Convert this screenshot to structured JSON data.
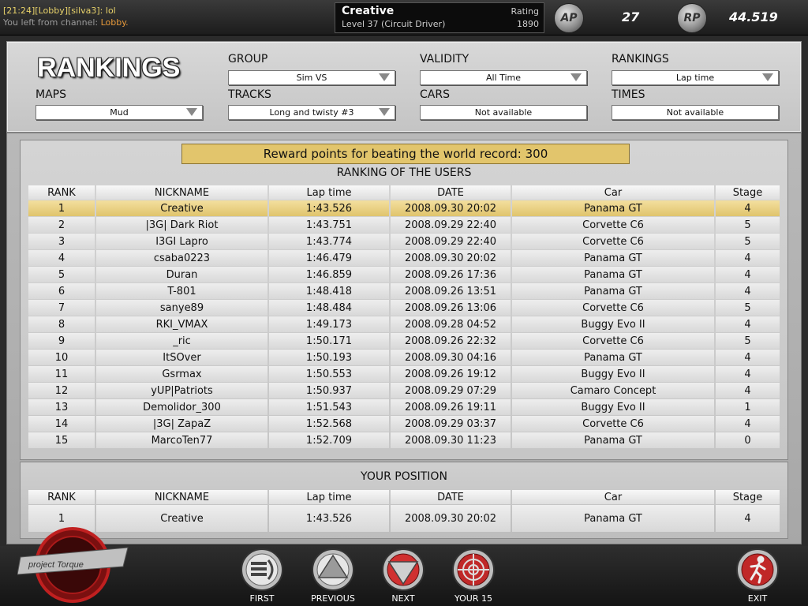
{
  "chat": {
    "line1": "[21:24][Lobby][silva3]: lol",
    "line2_prefix": "You left from channel: ",
    "line2_channel": "Lobby."
  },
  "player": {
    "name": "Creative",
    "level": "Level 37 (Circuit Driver)",
    "rating_label": "Rating",
    "rating_value": "1890"
  },
  "stats": {
    "coin1_icon": "AP-coin-icon",
    "coin1_value": "27",
    "coin2_icon": "RP-coin-icon",
    "coin2_value": "44.519"
  },
  "filters": {
    "title": "RANKINGS",
    "group_label": "GROUP",
    "group_value": "Sim VS",
    "validity_label": "VALIDITY",
    "validity_value": "All Time",
    "rankings_label": "RANKINGS",
    "rankings_value": "Lap time",
    "maps_label": "MAPS",
    "maps_value": "Mud",
    "tracks_label": "TRACKS",
    "tracks_value": "Long and twisty #3",
    "cars_label": "CARS",
    "cars_value": "Not available",
    "times_label": "TIMES",
    "times_value": "Not available"
  },
  "reward_text": "Reward points for beating the world record: 300",
  "ranking_title": "RANKING OF THE USERS",
  "columns": [
    "RANK",
    "NICKNAME",
    "Lap time",
    "DATE",
    "Car",
    "Stage"
  ],
  "rows": [
    [
      "1",
      "Creative",
      "1:43.526",
      "2008.09.30 20:02",
      "Panama GT",
      "4"
    ],
    [
      "2",
      "|3G| Dark Riot",
      "1:43.751",
      "2008.09.29 22:40",
      "Corvette C6",
      "5"
    ],
    [
      "3",
      "I3GI Lapro",
      "1:43.774",
      "2008.09.29 22:40",
      "Corvette C6",
      "5"
    ],
    [
      "4",
      "csaba0223",
      "1:46.479",
      "2008.09.30 20:02",
      "Panama GT",
      "4"
    ],
    [
      "5",
      "Duran",
      "1:46.859",
      "2008.09.26 17:36",
      "Panama GT",
      "4"
    ],
    [
      "6",
      "T-801",
      "1:48.418",
      "2008.09.26 13:51",
      "Panama GT",
      "4"
    ],
    [
      "7",
      "sanye89",
      "1:48.484",
      "2008.09.26 13:06",
      "Corvette C6",
      "5"
    ],
    [
      "8",
      "RKI_VMAX",
      "1:49.173",
      "2008.09.28 04:52",
      "Buggy Evo II",
      "4"
    ],
    [
      "9",
      "_ric",
      "1:50.171",
      "2008.09.26 22:32",
      "Corvette C6",
      "5"
    ],
    [
      "10",
      "ItSOver",
      "1:50.193",
      "2008.09.30 04:16",
      "Panama GT",
      "4"
    ],
    [
      "11",
      "Gsrmax",
      "1:50.553",
      "2008.09.26 19:12",
      "Buggy Evo II",
      "4"
    ],
    [
      "12",
      "yUP|Patriots",
      "1:50.937",
      "2008.09.29 07:29",
      "Camaro Concept",
      "4"
    ],
    [
      "13",
      "Demolidor_300",
      "1:51.543",
      "2008.09.26 19:11",
      "Buggy Evo II",
      "1"
    ],
    [
      "14",
      "|3G| ZapaZ",
      "1:52.568",
      "2008.09.29 03:37",
      "Corvette C6",
      "4"
    ],
    [
      "15",
      "MarcoTen77",
      "1:52.709",
      "2008.09.30 11:23",
      "Panama GT",
      "0"
    ]
  ],
  "your_position": {
    "title": "YOUR POSITION",
    "row": [
      "1",
      "Creative",
      "1:43.526",
      "2008.09.30 20:02",
      "Panama GT",
      "4"
    ]
  },
  "nav": {
    "first": "FIRST",
    "previous": "PREVIOUS",
    "next": "NEXT",
    "your15": "YOUR 15",
    "exit": "EXIT"
  },
  "logo_text": "project Torque"
}
